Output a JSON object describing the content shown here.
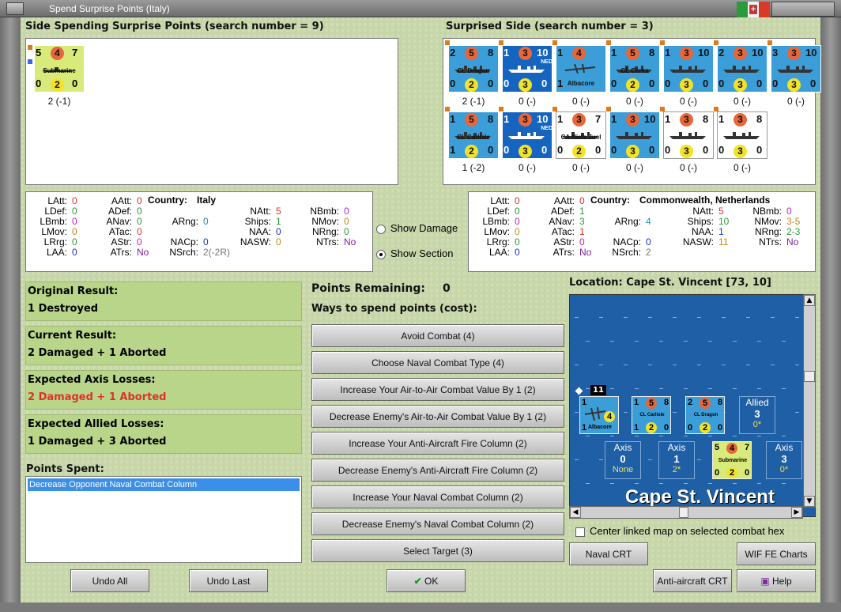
{
  "window": {
    "title": "Spend Surprise Points (Italy)"
  },
  "spending_side": {
    "header": "Side Spending Surprise Points (search number = 9)",
    "unit": {
      "top_left": "5",
      "top_mid": "4",
      "top_right": "7",
      "name": "Submarine",
      "bot_left": "0",
      "bot_mid": "2",
      "bot_right": "0",
      "caption": "2 (-1)"
    }
  },
  "surprised_side": {
    "header": "Surprised Side (search number = 3)",
    "units": [
      {
        "tl": "2",
        "tm": "5",
        "tr": "8",
        "name": "CL Dragon",
        "bl": "0",
        "bm": "2",
        "br": "0",
        "cap": "2 (-1)",
        "color": "#3b9ed8",
        "tag": ""
      },
      {
        "tl": "1",
        "tm": "3",
        "tr": "10",
        "name": "",
        "bl": "0",
        "bm": "3",
        "br": "0",
        "cap": "0 (-)",
        "color": "#1565c0",
        "tag": "NED"
      },
      {
        "tl": "1",
        "tm": "4",
        "tr": "",
        "name": "Albacore",
        "bl": "1",
        "bm": "",
        "br": "",
        "cap": "0 (-)",
        "color": "#3b9ed8",
        "tag": ""
      },
      {
        "tl": "1",
        "tm": "5",
        "tr": "8",
        "name": "CL Ceres",
        "bl": "0",
        "bm": "2",
        "br": "0",
        "cap": "0 (-)",
        "color": "#3b9ed8",
        "tag": ""
      },
      {
        "tl": "1",
        "tm": "3",
        "tr": "10",
        "name": "",
        "bl": "0",
        "bm": "3",
        "br": "0",
        "cap": "0 (-)",
        "color": "#3b9ed8",
        "tag": ""
      },
      {
        "tl": "2",
        "tm": "3",
        "tr": "10",
        "name": "",
        "bl": "0",
        "bm": "3",
        "br": "0",
        "cap": "0 (-)",
        "color": "#3b9ed8",
        "tag": ""
      },
      {
        "tl": "3",
        "tm": "3",
        "tr": "10",
        "name": "",
        "bl": "0",
        "bm": "3",
        "br": "0",
        "cap": "0 (-)",
        "color": "#3b9ed8",
        "tag": ""
      },
      {
        "tl": "1",
        "tm": "5",
        "tr": "8",
        "name": "CL Carlisle",
        "bl": "1",
        "bm": "2",
        "br": "0",
        "cap": "1 (-2)",
        "color": "#3b9ed8",
        "tag": ""
      },
      {
        "tl": "1",
        "tm": "3",
        "tr": "10",
        "name": "",
        "bl": "0",
        "bm": "3",
        "br": "0",
        "cap": "0 (-)",
        "color": "#1565c0",
        "tag": "NED"
      },
      {
        "tl": "1",
        "tm": "3",
        "tr": "7",
        "name": "CA Niels Juel",
        "bl": "0",
        "bm": "2",
        "br": "0",
        "cap": "0 (-)",
        "color": "#ffffff",
        "tag": ""
      },
      {
        "tl": "1",
        "tm": "3",
        "tr": "10",
        "name": "",
        "bl": "0",
        "bm": "3",
        "br": "0",
        "cap": "0 (-)",
        "color": "#3b9ed8",
        "tag": ""
      },
      {
        "tl": "1",
        "tm": "3",
        "tr": "8",
        "name": "",
        "bl": "0",
        "bm": "3",
        "br": "0",
        "cap": "0 (-)",
        "color": "#ffffff",
        "tag": ""
      },
      {
        "tl": "1",
        "tm": "3",
        "tr": "8",
        "name": "",
        "bl": "0",
        "bm": "3",
        "br": "0",
        "cap": "0 (-)",
        "color": "#ffffff",
        "tag": ""
      }
    ]
  },
  "stats_left": {
    "country_label": "Country:",
    "country": "Italy",
    "rows": [
      {
        "k": "LAtt:",
        "v": "0",
        "c": "#e0302a"
      },
      {
        "k": "LDef:",
        "v": "0",
        "c": "#2a9a3a"
      },
      {
        "k": "LBmb:",
        "v": "0",
        "c": "#c020c0"
      },
      {
        "k": "LMov:",
        "v": "0",
        "c": "#c08a1a"
      },
      {
        "k": "LRrg:",
        "v": "0",
        "c": "#2a9a3a"
      },
      {
        "k": "LAA:",
        "v": "0",
        "c": "#2030c0"
      },
      {
        "k": "AAtt:",
        "v": "0",
        "c": "#e0302a"
      },
      {
        "k": "ADef:",
        "v": "0",
        "c": "#2a9a3a"
      },
      {
        "k": "ANav:",
        "v": "0",
        "c": "#2a9a3a"
      },
      {
        "k": "ATac:",
        "v": "0",
        "c": "#e0302a"
      },
      {
        "k": "AStr:",
        "v": "0",
        "c": "#c020c0"
      },
      {
        "k": "ATrs:",
        "v": "No",
        "c": "#8020a0"
      },
      {
        "k": "ARng:",
        "v": "0",
        "c": "#2090b0"
      },
      {
        "k": "NACp:",
        "v": "0",
        "c": "#2030c0"
      },
      {
        "k": "NSrch:",
        "v": "2(-2R)",
        "c": "#777777"
      },
      {
        "k": "NAtt:",
        "v": "5",
        "c": "#e0302a"
      },
      {
        "k": "Ships:",
        "v": "1",
        "c": "#2a9a3a"
      },
      {
        "k": "NAA:",
        "v": "0",
        "c": "#2030c0"
      },
      {
        "k": "NASW:",
        "v": "0",
        "c": "#c08a1a"
      },
      {
        "k": "NBmb:",
        "v": "0",
        "c": "#c020c0"
      },
      {
        "k": "NMov:",
        "v": "0",
        "c": "#c08a1a"
      },
      {
        "k": "NRng:",
        "v": "0",
        "c": "#2a9a3a"
      },
      {
        "k": "NTrs:",
        "v": "No",
        "c": "#8020a0"
      }
    ]
  },
  "stats_right": {
    "country_label": "Country:",
    "country": "Commonwealth, Netherlands",
    "rows": [
      {
        "k": "LAtt:",
        "v": "0",
        "c": "#e0302a"
      },
      {
        "k": "LDef:",
        "v": "0",
        "c": "#2a9a3a"
      },
      {
        "k": "LBmb:",
        "v": "0",
        "c": "#c020c0"
      },
      {
        "k": "LMov:",
        "v": "0",
        "c": "#c08a1a"
      },
      {
        "k": "LRrg:",
        "v": "0",
        "c": "#2a9a3a"
      },
      {
        "k": "LAA:",
        "v": "0",
        "c": "#2030c0"
      },
      {
        "k": "AAtt:",
        "v": "0",
        "c": "#e0302a"
      },
      {
        "k": "ADef:",
        "v": "1",
        "c": "#2a9a3a"
      },
      {
        "k": "ANav:",
        "v": "3",
        "c": "#2a9a3a"
      },
      {
        "k": "ATac:",
        "v": "1",
        "c": "#e0302a"
      },
      {
        "k": "AStr:",
        "v": "0",
        "c": "#c020c0"
      },
      {
        "k": "ATrs:",
        "v": "No",
        "c": "#8020a0"
      },
      {
        "k": "ARng:",
        "v": "4",
        "c": "#2090b0"
      },
      {
        "k": "NACp:",
        "v": "0",
        "c": "#2030c0"
      },
      {
        "k": "NSrch:",
        "v": "2",
        "c": "#777777"
      },
      {
        "k": "NAtt:",
        "v": "5",
        "c": "#e0302a"
      },
      {
        "k": "Ships:",
        "v": "10",
        "c": "#2a9a3a"
      },
      {
        "k": "NAA:",
        "v": "1",
        "c": "#2030c0"
      },
      {
        "k": "NASW:",
        "v": "11",
        "c": "#c08a1a"
      },
      {
        "k": "NBmb:",
        "v": "0",
        "c": "#c020c0"
      },
      {
        "k": "NMov:",
        "v": "3-5",
        "c": "#c08a1a"
      },
      {
        "k": "NRng:",
        "v": "2-3",
        "c": "#2a9a3a"
      },
      {
        "k": "NTrs:",
        "v": "No",
        "c": "#8020a0"
      }
    ]
  },
  "options": {
    "show_damage": "Show Damage",
    "show_section": "Show Section",
    "selected": "show_section"
  },
  "results": {
    "original_label": "Original Result:",
    "original": "1 Destroyed",
    "current_label": "Current Result:",
    "current": "2 Damaged + 1 Aborted",
    "axis_label": "Expected Axis Losses:",
    "axis": "2 Damaged + 1 Aborted",
    "allied_label": "Expected Allied Losses:",
    "allied": "1 Damaged + 3 Aborted",
    "spent_label": "Points Spent:",
    "spent_items": [
      "Decrease Opponent Naval Combat Column"
    ]
  },
  "points": {
    "remaining_label": "Points Remaining:",
    "remaining": "0",
    "ways_label": "Ways to spend points (cost):"
  },
  "spend_buttons": [
    "Avoid Combat (4)",
    "Choose Naval Combat Type (4)",
    "Increase Your Air-to-Air Combat Value By 1 (2)",
    "Decrease Enemy's Air-to-Air Combat Value By 1 (2)",
    "Increase Your Anti-Aircraft Fire Column (2)",
    "Decrease Enemy's Anti-Aircraft Fire Column (2)",
    "Increase Your Naval Combat Column (2)",
    "Decrease Enemy's Naval Combat Column (2)",
    "Select Target (3)"
  ],
  "map": {
    "location": "Location: Cape St. Vincent [73, 10]",
    "place_name": "Cape St. Vincent",
    "stack_count": "11",
    "units": [
      {
        "name": "Albacore",
        "tl": "1",
        "tm": "4",
        "bl": "1"
      },
      {
        "name": "CL Carlisle",
        "tl": "1",
        "tm": "5",
        "tr": "8",
        "bl": "1",
        "bm": "2",
        "br": "0"
      },
      {
        "name": "CL Dragon",
        "tl": "2",
        "tm": "5",
        "tr": "8",
        "bl": "0",
        "bm": "2",
        "br": "0"
      },
      {
        "name": "Submarine",
        "tl": "5",
        "tm": "4",
        "tr": "7",
        "bl": "0",
        "bm": "2",
        "br": "0"
      }
    ],
    "allied_box": {
      "label": "Allied",
      "value": "3",
      "sub": "0*"
    },
    "axis_boxes": [
      {
        "label": "Axis",
        "value": "0",
        "sub": "None"
      },
      {
        "label": "Axis",
        "value": "1",
        "sub": "2*"
      },
      {
        "label": "Axis",
        "value": "3",
        "sub": "0*"
      }
    ],
    "center_linked": "Center linked map on selected combat hex"
  },
  "buttons": {
    "undo_all": "Undo All",
    "undo_last": "Undo Last",
    "ok": "OK",
    "naval_crt": "Naval CRT",
    "aa_crt": "Anti-aircraft CRT",
    "wif_charts": "WIF FE Charts",
    "help": "Help"
  },
  "colors": {
    "client_bg": "#c7d6a8",
    "result_bg": "#b9d58a",
    "axis_loss": "#e0302a",
    "map_sea": "#1f5fa5"
  }
}
